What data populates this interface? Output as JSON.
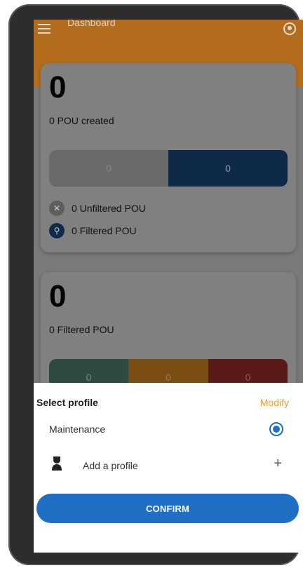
{
  "header": {
    "title": "Dashboard"
  },
  "card1": {
    "count": "0",
    "subtitle": "0 POU created",
    "bar": {
      "left_value": "0",
      "right_value": "0"
    },
    "legend": {
      "unfiltered": "0 Unfiltered POU",
      "filtered": "0 Filtered POU"
    }
  },
  "card2": {
    "count": "0",
    "subtitle": "0 Filtered POU",
    "bar": {
      "green_value": "0",
      "orange_value": "0",
      "red_value": "0"
    }
  },
  "sheet": {
    "title": "Select profile",
    "modify_label": "Modify",
    "option_label": "Maintenance",
    "add_label": "Add a profile",
    "plus_symbol": "+",
    "confirm_label": "CONFIRM"
  },
  "colors": {
    "accent": "#f0a030",
    "primary": "#1f6fc4"
  }
}
